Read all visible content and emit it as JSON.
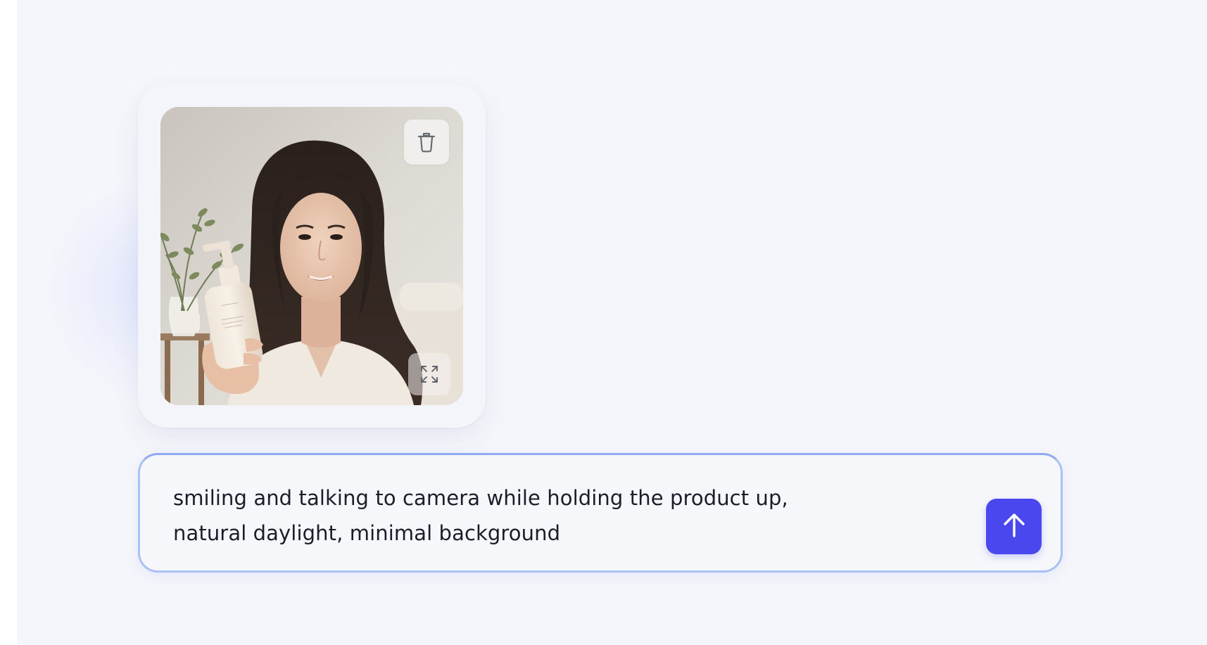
{
  "colors": {
    "background": "#f5f6fb",
    "accent": "#4a47ef",
    "border": "#a9c1f4",
    "text": "#1b1d2a"
  },
  "attachment": {
    "delete_icon": "trash-icon",
    "expand_icon": "expand-icon"
  },
  "prompt": {
    "text": "smiling and talking to camera while holding the product up,\nnatural daylight, minimal background",
    "send_icon": "arrow-up-icon"
  }
}
